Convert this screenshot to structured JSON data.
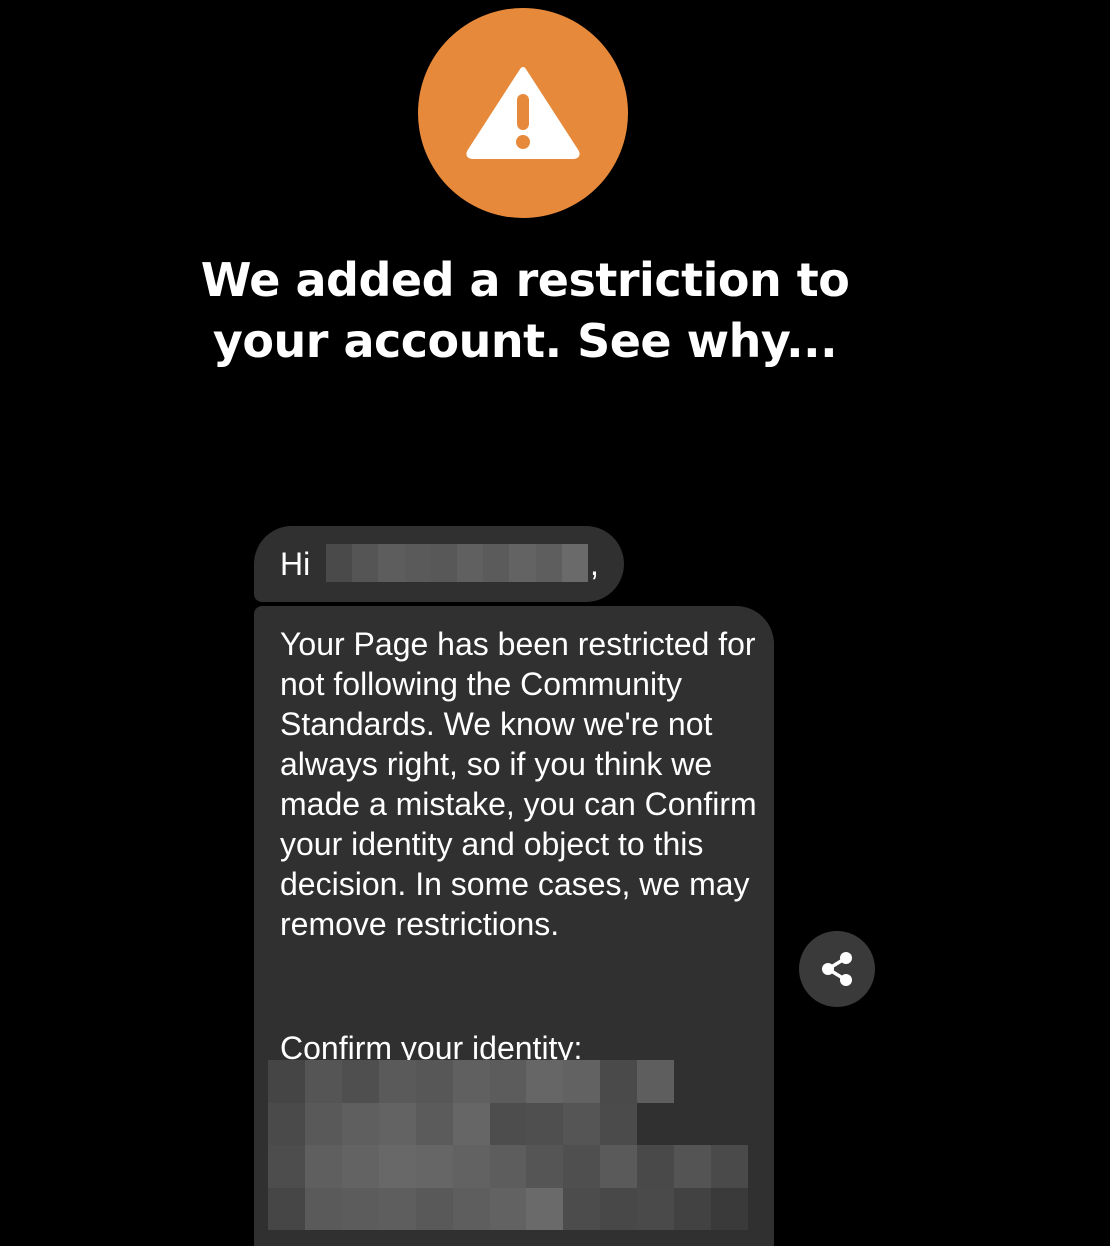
{
  "alert": {
    "icon": "warning-icon",
    "icon_color": "#E6893A",
    "headline": "We added a restriction to your account. See why..."
  },
  "message": {
    "greeting_prefix": "Hi",
    "greeting_suffix": ",",
    "body": "Your Page has been restricted for not following the Community Standards. We know we're not always right, so if you think we made a mistake, you can Confirm your identity and object to this decision. In some cases, we may remove restrictions.",
    "confirm_label": "Confirm your identity:",
    "bubble_color": "#303030"
  },
  "actions": {
    "share_icon": "share-icon"
  }
}
